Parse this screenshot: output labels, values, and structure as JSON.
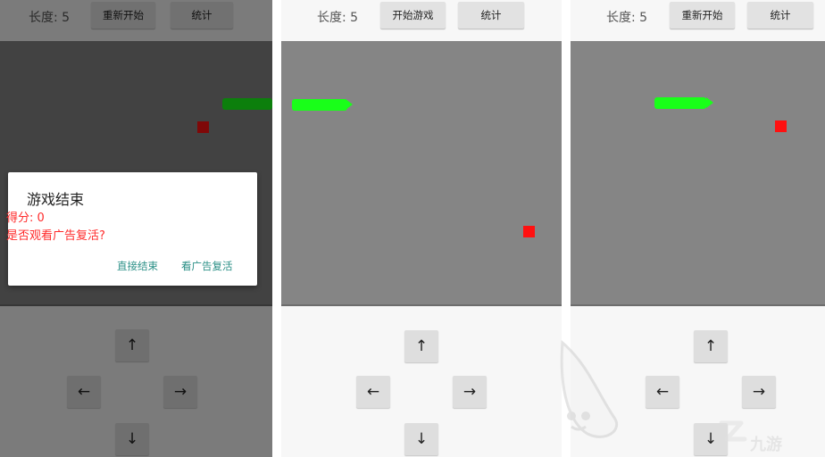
{
  "panels": [
    {
      "length_label": "长度: 5",
      "start_button": "重新开始",
      "stats_button": "统计",
      "dpad": {
        "up": "↑",
        "left": "←",
        "right": "→",
        "down": "↓"
      }
    },
    {
      "length_label": "长度: 5",
      "start_button": "开始游戏",
      "stats_button": "统计",
      "dpad": {
        "up": "↑",
        "left": "←",
        "right": "→",
        "down": "↓"
      }
    },
    {
      "length_label": "长度: 5",
      "start_button": "重新开始",
      "stats_button": "统计",
      "dpad": {
        "up": "↑",
        "left": "←",
        "right": "→",
        "down": "↓"
      }
    }
  ],
  "dialog": {
    "title": "游戏结束",
    "score": "得分: 0",
    "question": "是否观看广告复活?",
    "end_button": "直接结束",
    "revive_button": "看广告复活"
  },
  "watermark": {
    "brand": "九游",
    "icon": "leaf-mascot-icon"
  },
  "colors": {
    "snake": "#19ff19",
    "food": "#ff1010",
    "board": "#858585",
    "dialog_accent": "#2a8f86",
    "dialog_alert": "#ff2b2b"
  }
}
